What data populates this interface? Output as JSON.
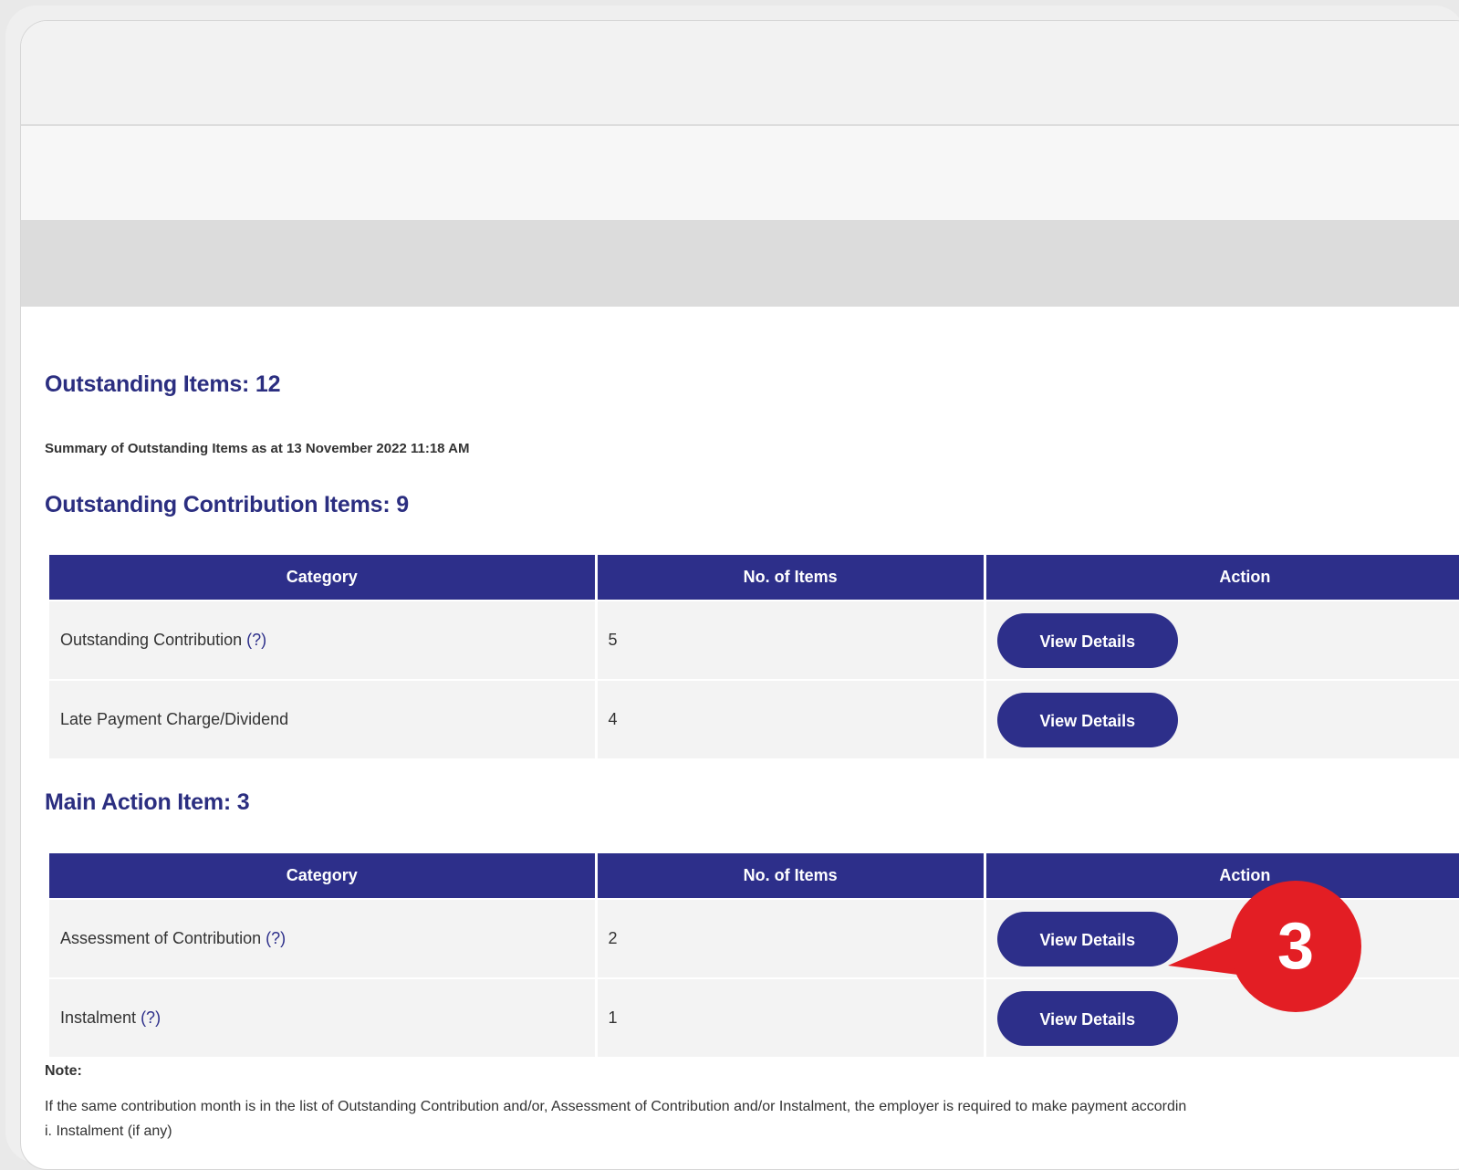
{
  "outstanding_items": {
    "title": "Outstanding Items: 12",
    "summary": "Summary of Outstanding Items as at 13 November 2022 11:18 AM"
  },
  "contribution_section": {
    "title": "Outstanding Contribution Items: 9",
    "headers": [
      "Category",
      "No. of Items",
      "Action"
    ],
    "rows": [
      {
        "category": "Outstanding Contribution",
        "help": "(?)",
        "count": "5",
        "action": "View Details"
      },
      {
        "category": "Late Payment Charge/Dividend",
        "help": "",
        "count": "4",
        "action": "View Details"
      }
    ]
  },
  "main_action_section": {
    "title": "Main Action Item: 3",
    "headers": [
      "Category",
      "No. of Items",
      "Action"
    ],
    "rows": [
      {
        "category": "Assessment of Contribution",
        "help": "(?)",
        "count": "2",
        "action": "View Details"
      },
      {
        "category": "Instalment",
        "help": "(?)",
        "count": "1",
        "action": "View Details"
      }
    ]
  },
  "note": {
    "label": "Note:",
    "text": "If the same contribution month is in the list of Outstanding Contribution and/or, Assessment of Contribution and/or Instalment, the employer is required to make payment accordin",
    "sub": "i. Instalment (if any)"
  },
  "callout": {
    "number": "3",
    "color": "#e31e24"
  },
  "colors": {
    "brand": "#2d2f8a",
    "row_bg": "#f3f3f3",
    "callout": "#e31e24"
  }
}
